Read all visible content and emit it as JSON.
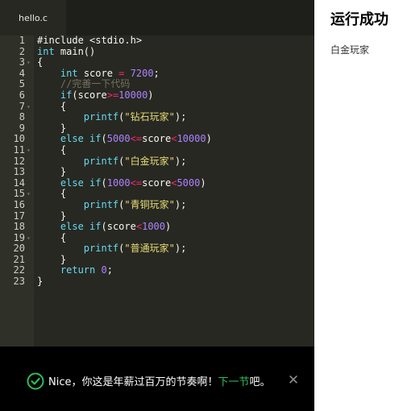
{
  "editor": {
    "tab_label": "hello.c",
    "lines": [
      {
        "n": "1",
        "fold": "",
        "tokens": [
          {
            "t": "#include <stdio.h>",
            "c": "plain"
          }
        ]
      },
      {
        "n": "2",
        "fold": "",
        "tokens": [
          {
            "t": "int",
            "c": "kw"
          },
          {
            "t": " main()",
            "c": "plain"
          }
        ]
      },
      {
        "n": "3",
        "fold": "▾",
        "tokens": [
          {
            "t": "{",
            "c": "plain"
          }
        ]
      },
      {
        "n": "4",
        "fold": "",
        "tokens": [
          {
            "t": "    ",
            "c": "plain"
          },
          {
            "t": "int",
            "c": "kw"
          },
          {
            "t": " score ",
            "c": "plain"
          },
          {
            "t": "=",
            "c": "op"
          },
          {
            "t": " ",
            "c": "plain"
          },
          {
            "t": "7200",
            "c": "num"
          },
          {
            "t": ";",
            "c": "plain"
          }
        ]
      },
      {
        "n": "5",
        "fold": "",
        "tokens": [
          {
            "t": "    ",
            "c": "plain"
          },
          {
            "t": "//完善一下代码",
            "c": "cmt"
          }
        ]
      },
      {
        "n": "6",
        "fold": "",
        "tokens": [
          {
            "t": "    ",
            "c": "plain"
          },
          {
            "t": "if",
            "c": "kw"
          },
          {
            "t": "(score",
            "c": "plain"
          },
          {
            "t": ">=",
            "c": "op"
          },
          {
            "t": "10000",
            "c": "num"
          },
          {
            "t": ")",
            "c": "plain"
          }
        ]
      },
      {
        "n": "7",
        "fold": "▾",
        "tokens": [
          {
            "t": "    {",
            "c": "plain"
          }
        ]
      },
      {
        "n": "8",
        "fold": "",
        "tokens": [
          {
            "t": "        ",
            "c": "plain"
          },
          {
            "t": "printf",
            "c": "fn"
          },
          {
            "t": "(",
            "c": "plain"
          },
          {
            "t": "\"钻石玩家\"",
            "c": "str"
          },
          {
            "t": ");",
            "c": "plain"
          }
        ]
      },
      {
        "n": "9",
        "fold": "",
        "tokens": [
          {
            "t": "    }",
            "c": "plain"
          }
        ]
      },
      {
        "n": "10",
        "fold": "",
        "tokens": [
          {
            "t": "    ",
            "c": "plain"
          },
          {
            "t": "else",
            "c": "kw"
          },
          {
            "t": " ",
            "c": "plain"
          },
          {
            "t": "if",
            "c": "kw"
          },
          {
            "t": "(",
            "c": "plain"
          },
          {
            "t": "5000",
            "c": "num"
          },
          {
            "t": "<=",
            "c": "op"
          },
          {
            "t": "score",
            "c": "plain"
          },
          {
            "t": "<",
            "c": "op"
          },
          {
            "t": "10000",
            "c": "num"
          },
          {
            "t": ")",
            "c": "plain"
          }
        ]
      },
      {
        "n": "11",
        "fold": "▾",
        "tokens": [
          {
            "t": "    {",
            "c": "plain"
          }
        ]
      },
      {
        "n": "12",
        "fold": "",
        "tokens": [
          {
            "t": "        ",
            "c": "plain"
          },
          {
            "t": "printf",
            "c": "fn"
          },
          {
            "t": "(",
            "c": "plain"
          },
          {
            "t": "\"白金玩家\"",
            "c": "str"
          },
          {
            "t": ");",
            "c": "plain"
          }
        ]
      },
      {
        "n": "13",
        "fold": "",
        "tokens": [
          {
            "t": "    }",
            "c": "plain"
          }
        ]
      },
      {
        "n": "14",
        "fold": "",
        "tokens": [
          {
            "t": "    ",
            "c": "plain"
          },
          {
            "t": "else",
            "c": "kw"
          },
          {
            "t": " ",
            "c": "plain"
          },
          {
            "t": "if",
            "c": "kw"
          },
          {
            "t": "(",
            "c": "plain"
          },
          {
            "t": "1000",
            "c": "num"
          },
          {
            "t": "<=",
            "c": "op"
          },
          {
            "t": "score",
            "c": "plain"
          },
          {
            "t": "<",
            "c": "op"
          },
          {
            "t": "5000",
            "c": "num"
          },
          {
            "t": ")",
            "c": "plain"
          }
        ]
      },
      {
        "n": "15",
        "fold": "▾",
        "tokens": [
          {
            "t": "    {",
            "c": "plain"
          }
        ]
      },
      {
        "n": "16",
        "fold": "",
        "tokens": [
          {
            "t": "        ",
            "c": "plain"
          },
          {
            "t": "printf",
            "c": "fn"
          },
          {
            "t": "(",
            "c": "plain"
          },
          {
            "t": "\"青铜玩家\"",
            "c": "str"
          },
          {
            "t": ");",
            "c": "plain"
          }
        ]
      },
      {
        "n": "17",
        "fold": "",
        "tokens": [
          {
            "t": "    }",
            "c": "plain"
          }
        ]
      },
      {
        "n": "18",
        "fold": "",
        "tokens": [
          {
            "t": "    ",
            "c": "plain"
          },
          {
            "t": "else",
            "c": "kw"
          },
          {
            "t": " ",
            "c": "plain"
          },
          {
            "t": "if",
            "c": "kw"
          },
          {
            "t": "(score",
            "c": "plain"
          },
          {
            "t": "<",
            "c": "op"
          },
          {
            "t": "1000",
            "c": "num"
          },
          {
            "t": ")",
            "c": "plain"
          }
        ]
      },
      {
        "n": "19",
        "fold": "▾",
        "tokens": [
          {
            "t": "    {",
            "c": "plain"
          }
        ]
      },
      {
        "n": "20",
        "fold": "",
        "tokens": [
          {
            "t": "        ",
            "c": "plain"
          },
          {
            "t": "printf",
            "c": "fn"
          },
          {
            "t": "(",
            "c": "plain"
          },
          {
            "t": "\"普通玩家\"",
            "c": "str"
          },
          {
            "t": ");",
            "c": "plain"
          }
        ]
      },
      {
        "n": "21",
        "fold": "",
        "tokens": [
          {
            "t": "    }",
            "c": "plain"
          }
        ]
      },
      {
        "n": "22",
        "fold": "",
        "tokens": [
          {
            "t": "    ",
            "c": "plain"
          },
          {
            "t": "return",
            "c": "kw"
          },
          {
            "t": " ",
            "c": "plain"
          },
          {
            "t": "0",
            "c": "num"
          },
          {
            "t": ";",
            "c": "plain"
          }
        ]
      },
      {
        "n": "23",
        "fold": "",
        "tokens": [
          {
            "t": "}",
            "c": "plain"
          }
        ]
      }
    ]
  },
  "toast": {
    "message": "Nice，你这是年薪过百万的节奏啊！",
    "link_label": "下一节",
    "suffix": "吧。",
    "close_glyph": "✕",
    "accent_color": "#2ebd59"
  },
  "result": {
    "title": "运行成功",
    "output": "白金玩家"
  }
}
